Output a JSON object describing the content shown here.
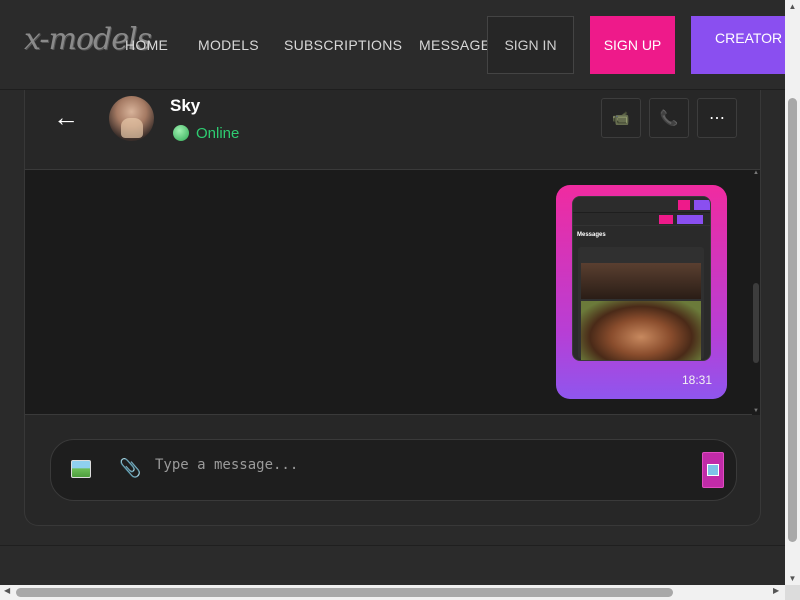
{
  "brand": {
    "logo_text": "x-models"
  },
  "nav": {
    "links": [
      {
        "label": "HOME"
      },
      {
        "label": "MODELS"
      },
      {
        "label": "SUBSCRIPTIONS"
      },
      {
        "label": "MESSAGES"
      }
    ],
    "sign_in": "SIGN IN",
    "sign_up": "SIGN UP",
    "creator_dashboard": "CREATOR DASHBOARD"
  },
  "chat": {
    "back_icon": "arrow-left-icon",
    "contact": {
      "name": "Sky",
      "status": "Online"
    },
    "actions": [
      {
        "icon": "video-camera-icon",
        "glyph": "📹"
      },
      {
        "icon": "phone-icon",
        "glyph": "📞"
      },
      {
        "icon": "more-icon",
        "glyph": "⋯"
      }
    ],
    "messages": [
      {
        "type": "image",
        "title_in_image": "Messages",
        "time": "18:31"
      }
    ],
    "composer": {
      "placeholder": "Type a message...",
      "image_icon": "image-icon",
      "attach_icon": "paperclip-icon",
      "send_icon": "send-icon"
    }
  },
  "colors": {
    "accent_pink": "#ee1a8a",
    "accent_purple": "#8a4ff0",
    "online_green": "#2ecc71",
    "background": "#2a2a2a"
  }
}
